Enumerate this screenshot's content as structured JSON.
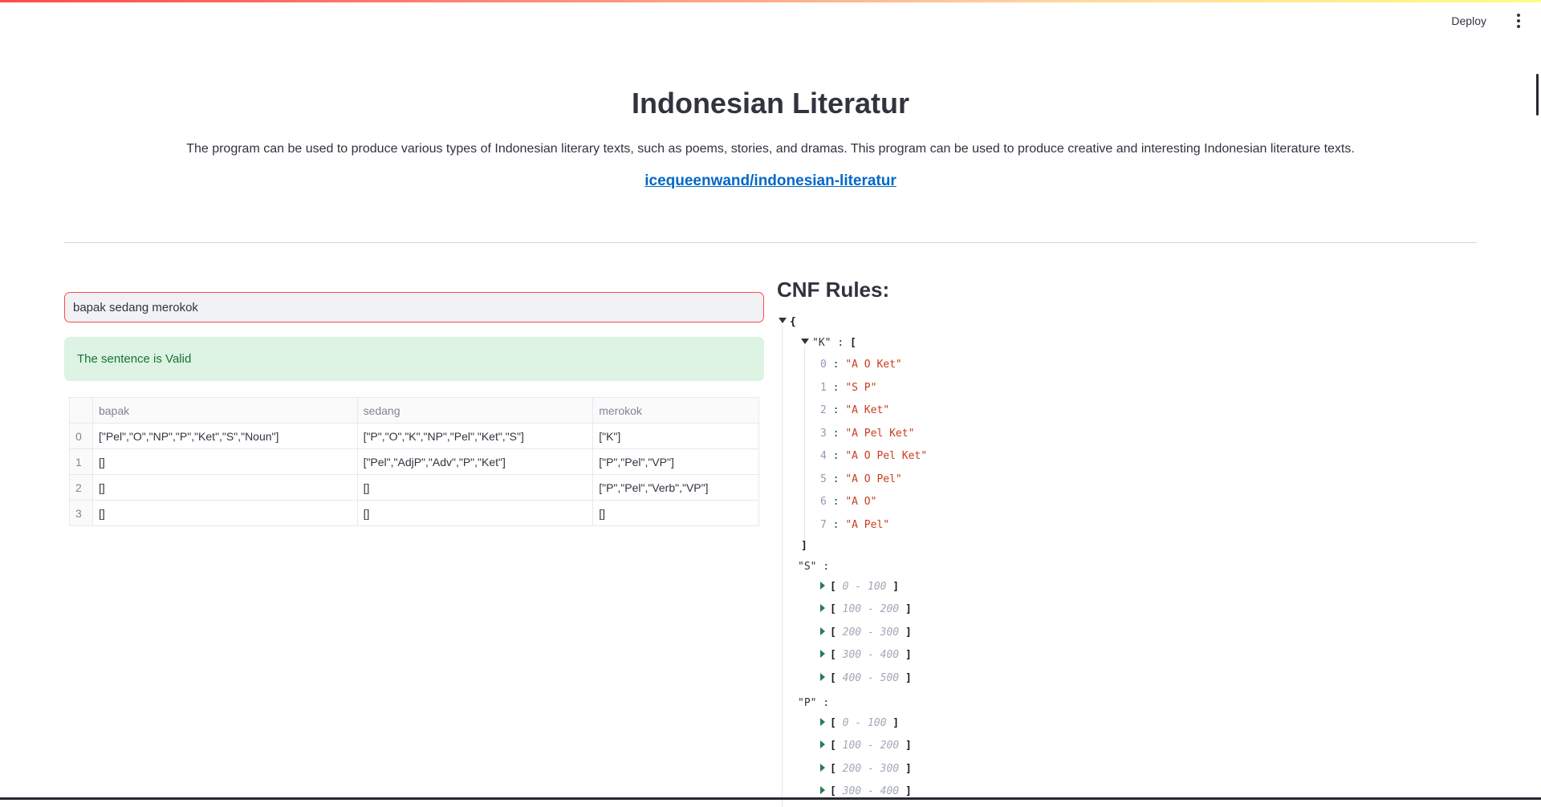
{
  "header": {
    "deploy_label": "Deploy",
    "menu_icon": "kebab-menu-icon"
  },
  "main": {
    "title": "Indonesian Literatur",
    "description": "The program can be used to produce various types of Indonesian literary texts, such as poems, stories, and dramas. This program can be used to produce creative and interesting Indonesian literature texts.",
    "repo_link": "icequeenwand/indonesian-literatur"
  },
  "input": {
    "value": "bapak sedang merokok"
  },
  "result": {
    "message": "The sentence is Valid"
  },
  "table": {
    "columns": [
      "bapak",
      "sedang",
      "merokok"
    ],
    "rows": [
      {
        "index": "0",
        "cells": [
          "[\"Pel\",\"O\",\"NP\",\"P\",\"Ket\",\"S\",\"Noun\"]",
          "[\"P\",\"O\",\"K\",\"NP\",\"Pel\",\"Ket\",\"S\"]",
          "[\"K\"]"
        ]
      },
      {
        "index": "1",
        "cells": [
          "[]",
          "[\"Pel\",\"AdjP\",\"Adv\",\"P\",\"Ket\"]",
          "[\"P\",\"Pel\",\"VP\"]"
        ]
      },
      {
        "index": "2",
        "cells": [
          "[]",
          "[]",
          "[\"P\",\"Pel\",\"Verb\",\"VP\"]"
        ]
      },
      {
        "index": "3",
        "cells": [
          "[]",
          "[]",
          "[]"
        ]
      }
    ]
  },
  "cnf": {
    "title": "CNF Rules:",
    "open_brace": "{",
    "k_key": "\"K\"",
    "colon": ":",
    "open_bracket": "[",
    "close_bracket": "]",
    "k_items": [
      {
        "i": "0",
        "v": "\"A O Ket\""
      },
      {
        "i": "1",
        "v": "\"S P\""
      },
      {
        "i": "2",
        "v": "\"A Ket\""
      },
      {
        "i": "3",
        "v": "\"A Pel Ket\""
      },
      {
        "i": "4",
        "v": "\"A O Pel Ket\""
      },
      {
        "i": "5",
        "v": "\"A O Pel\""
      },
      {
        "i": "6",
        "v": "\"A O\""
      },
      {
        "i": "7",
        "v": "\"A Pel\""
      }
    ],
    "s_key": "\"S\"",
    "s_ranges": [
      "0 - 100",
      "100 - 200",
      "200 - 300",
      "300 - 400",
      "400 - 500"
    ],
    "p_key": "\"P\"",
    "p_ranges": [
      "0 - 100",
      "100 - 200",
      "200 - 300",
      "300 - 400"
    ]
  }
}
